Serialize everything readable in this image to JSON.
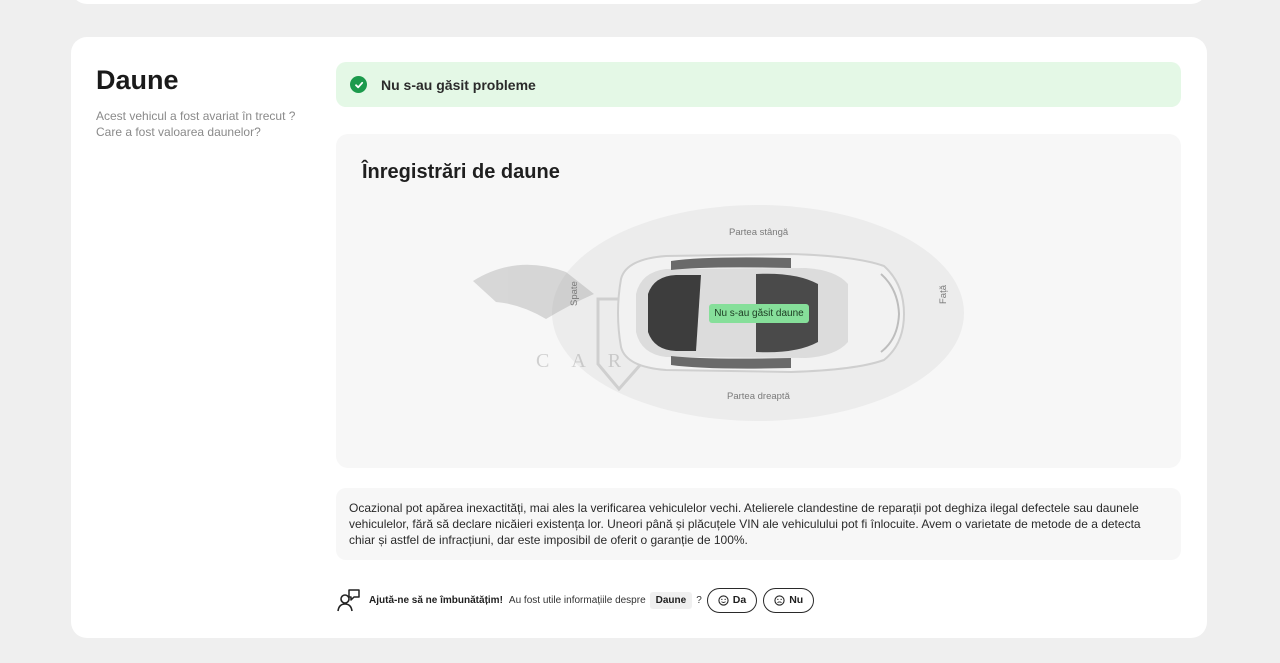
{
  "section": {
    "title": "Daune",
    "subtitle": "Acest vehicul a fost avariat în trecut ? Care a fost valoarea daunelor?"
  },
  "status": {
    "text": "Nu s-au găsit probleme",
    "icon": "check-circle-icon",
    "color": "#1c9a4c"
  },
  "damage_records": {
    "title": "Înregistrări de daune",
    "labels": {
      "left": "Partea stângă",
      "right": "Partea dreaptă",
      "back": "Spate",
      "front": "Față"
    },
    "badge": "Nu s-au găsit daune",
    "watermark": "CARSBAT"
  },
  "disclaimer": "Ocazional pot apărea inexactități, mai ales la verificarea vehiculelor vechi. Atelierele clandestine de reparații pot deghiza ilegal defectele sau daunele vehiculelor, fără să declare nicăieri existența lor. Uneori până și plăcuțele VIN ale vehiculului pot fi înlocuite. Avem o varietate de metode de a detecta chiar și astfel de infracțiuni, dar este imposibil de oferit o garanție de 100%.",
  "feedback": {
    "prompt_strong": "Ajută-ne să ne îmbunătățim!",
    "question": "Au fost utile informațiile despre",
    "topic": "Daune",
    "qmark": "?",
    "yes_label": "Da",
    "no_label": "Nu"
  }
}
